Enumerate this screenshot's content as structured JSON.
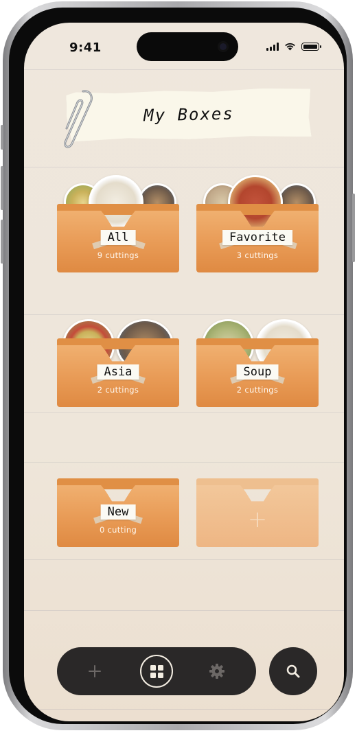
{
  "status_bar": {
    "time": "9:41"
  },
  "page": {
    "title": "My Boxes"
  },
  "boxes": [
    {
      "name": "All",
      "count": "9 cuttings"
    },
    {
      "name": "Favorite",
      "count": "3 cuttings"
    },
    {
      "name": "Asia",
      "count": "2 cuttings"
    },
    {
      "name": "Soup",
      "count": "2 cuttings"
    },
    {
      "name": "New",
      "count": "0 cutting"
    }
  ],
  "add_box": {
    "icon": "plus-icon",
    "label": "+"
  },
  "tab_bar": {
    "items": [
      {
        "icon": "plus-icon",
        "label": "+"
      },
      {
        "icon": "grid-icon",
        "active": true
      },
      {
        "icon": "gear-icon"
      }
    ],
    "search": {
      "icon": "search-icon"
    }
  },
  "colors": {
    "background": "#efe7dd",
    "folder": "#e89a55",
    "tab_bar": "#2a2828",
    "paper": "#faf7ea"
  }
}
